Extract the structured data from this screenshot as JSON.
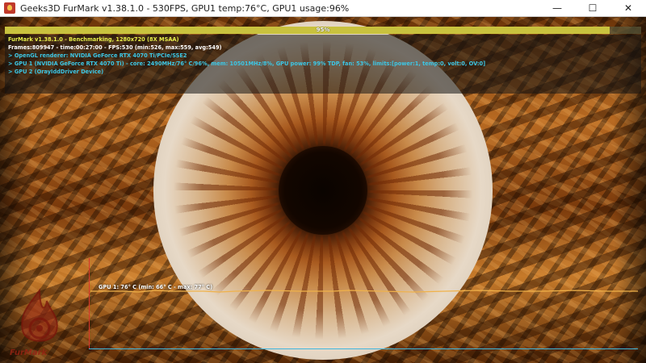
{
  "window": {
    "title": "Geeks3D FurMark v1.38.1.0 - 530FPS, GPU1 temp:76°C, GPU1 usage:96%",
    "controls": {
      "minimize": "—",
      "maximize": "☐",
      "close": "✕"
    }
  },
  "progress": {
    "label": "95%",
    "percent": 95
  },
  "info": {
    "title_line": "FurMark v1.38.1.0 - Benchmarking, 1280x720 (8X MSAA)",
    "frames_line": "Frames:809947 - time:00:27:00 - FPS:530 (min:526, max:559, avg:549)",
    "renderer_line": "> OpenGL renderer: NVIDIA GeForce RTX 4070 Ti/PCIe/SSE2",
    "gpu1_line": "> GPU 1 (NVIDIA GeForce RTX 4070 Ti) - core: 2490MHz/76° C/96%, mem: 10501MHz/8%, GPU power: 99% TDP, fan: 53%, limits:[power:1, temp:0, volt:0, OV:0]",
    "gpu2_line": "> GPU 2 (OrayIddDriver Device)"
  },
  "graph": {
    "label": "GPU 1: 76° C (min: 66° C - max: 77° C)"
  },
  "logo": {
    "text": "FurMark"
  },
  "colors": {
    "title_yellow": "#e7ef4b",
    "info_cyan": "#3cc7e6",
    "progress_fill": "#c9c23e",
    "graph_line": "#f0b24a",
    "axis_red": "#d9362b",
    "axis_blue": "#3fb6e0"
  }
}
